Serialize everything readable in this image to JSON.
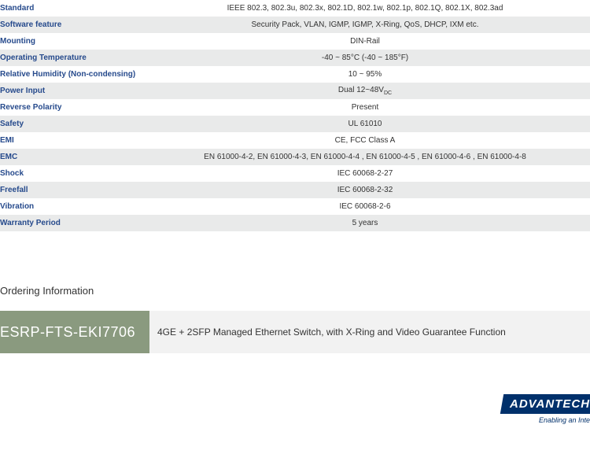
{
  "specs": {
    "rows": [
      {
        "label": "Standard",
        "value": "IEEE 802.3, 802.3u, 802.3x, 802.1D, 802.1w, 802.1p, 802.1Q, 802.1X, 802.3ad"
      },
      {
        "label": "Software feature",
        "value": "Security Pack, VLAN, IGMP, IGMP, X-Ring, QoS, DHCP, IXM etc."
      },
      {
        "label": "Mounting",
        "value": "DIN-Rail"
      },
      {
        "label": "Operating Temperature",
        "value": "-40 ~ 85°C (-40 ~ 185°F)"
      },
      {
        "label": "Relative Humidity (Non-condensing)",
        "value": "10 ~ 95%"
      },
      {
        "label": "Power Input",
        "value": "Dual 12~48V",
        "subscript": "DC"
      },
      {
        "label": "Reverse Polarity",
        "value": "Present"
      },
      {
        "label": "Safety",
        "value": "UL 61010"
      },
      {
        "label": "EMI",
        "value": "CE, FCC Class A"
      },
      {
        "label": "EMC",
        "value": "EN 61000-4-2, EN 61000-4-3, EN 61000-4-4 , EN 61000-4-5 , EN 61000-4-6 , EN 61000-4-8"
      },
      {
        "label": "Shock",
        "value": "IEC 60068-2-27"
      },
      {
        "label": "Freefall",
        "value": "IEC 60068-2-32"
      },
      {
        "label": "Vibration",
        "value": "IEC 60068-2-6"
      },
      {
        "label": "Warranty Period",
        "value": "5 years"
      }
    ]
  },
  "ordering": {
    "heading": "Ordering Information",
    "code": "ESRP-FTS-EKI7706",
    "description": "4GE + 2SFP Managed Ethernet Switch,  with X-Ring and Video Guarantee Function"
  },
  "logo": {
    "brand": "ADVANTECH",
    "tagline": "Enabling an Inte"
  }
}
